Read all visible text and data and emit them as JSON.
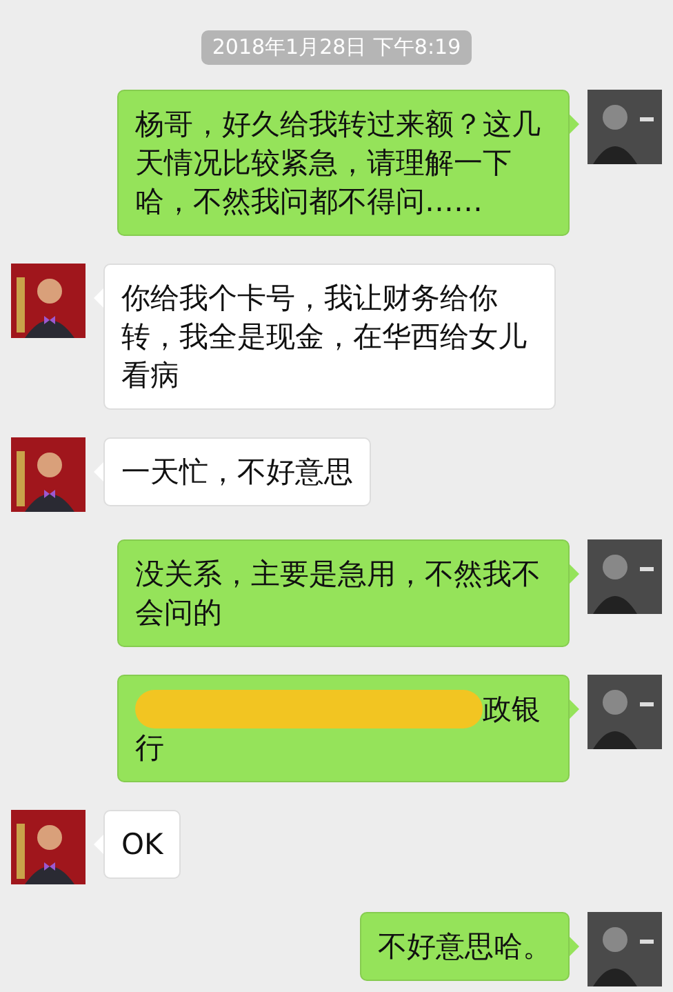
{
  "messages": [
    {
      "kind": "timestamp",
      "text": "2018年1月28日 下午8:19"
    },
    {
      "kind": "text",
      "outgoing": true,
      "text": "杨哥，好久给我转过来额？这几天情况比较紧急，请理解一下哈，不然我问都不得问……"
    },
    {
      "kind": "text",
      "outgoing": false,
      "text": "你给我个卡号，我让财务给你转，我全是现金，在华西给女儿看病"
    },
    {
      "kind": "text",
      "outgoing": false,
      "text": "一天忙，不好意思"
    },
    {
      "kind": "text",
      "outgoing": true,
      "text": "没关系，主要是急用，不然我不会问的"
    },
    {
      "kind": "redacted",
      "outgoing": true,
      "lines": [
        "政银",
        "行"
      ]
    },
    {
      "kind": "text",
      "outgoing": false,
      "text": "OK"
    },
    {
      "kind": "text",
      "outgoing": true,
      "text": "不好意思哈。"
    }
  ]
}
